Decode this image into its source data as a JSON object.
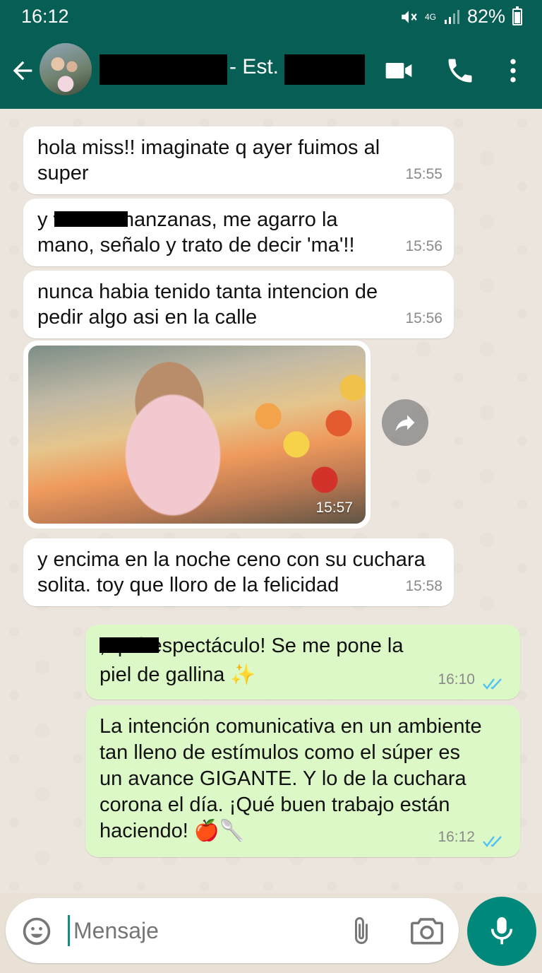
{
  "status_bar": {
    "time": "16:12",
    "network": "4G",
    "battery": "82%"
  },
  "header": {
    "contact_mid": "- Est."
  },
  "messages": [
    {
      "text_lines": [
        "hola miss!! imaginate q ayer fuimos al",
        "super"
      ],
      "time": "15:55"
    },
    {
      "text_lines": [
        "y        vio las manzanas, me agarro la",
        "mano, señalo y trato de decir 'ma'!!"
      ],
      "time": "15:56"
    },
    {
      "text_lines": [
        "nunca habia tenido tanta intencion de",
        "pedir algo asi en la calle"
      ],
      "time": "15:56"
    },
    {
      "image_time": "15:57"
    },
    {
      "text_lines": [
        "y encima en la noche ceno con su cuchara",
        "solita. toy que lloro de la felicidad"
      ],
      "time": "15:58"
    },
    {
      "text_lines": [
        "         , qué espectáculo! Se me pone la",
        "piel de gallina ✨"
      ],
      "time": "16:10"
    },
    {
      "text_lines": [
        "La intención comunicativa en un ambiente",
        "tan lleno de estímulos como el súper es",
        "un avance GIGANTE. Y lo de la cuchara",
        "corona el día. ¡Qué buen trabajo están",
        "haciendo! 🍎🥄"
      ],
      "time": "16:12"
    }
  ],
  "input": {
    "placeholder": "Mensaje"
  },
  "icons": {
    "back": "back-arrow-icon",
    "video": "video-call-icon",
    "call": "phone-icon",
    "menu": "more-vertical-icon",
    "emoji": "emoji-icon",
    "attach": "paperclip-icon",
    "camera": "camera-icon",
    "mic": "microphone-icon",
    "forward": "forward-icon",
    "read": "double-check-icon"
  },
  "colors": {
    "header": "#075e54",
    "outgoing": "#dcf8c6",
    "incoming": "#ffffff",
    "read_ticks": "#4fc3f7",
    "mic_button": "#00897b"
  }
}
